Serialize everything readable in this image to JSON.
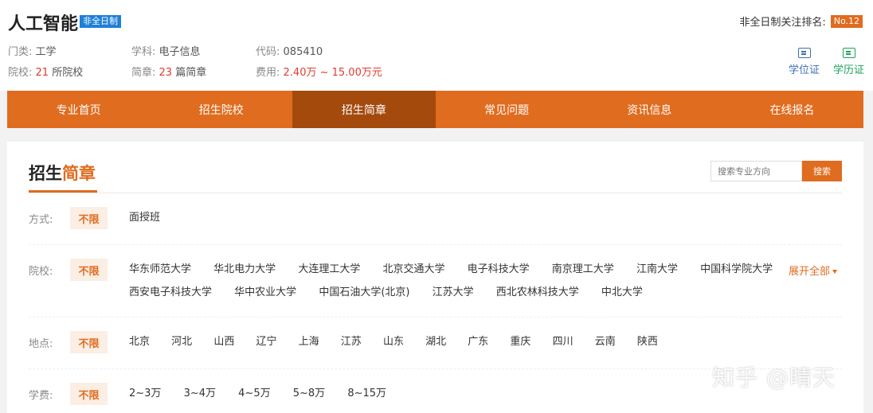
{
  "header": {
    "title": "人工智能",
    "badge": "非全日制",
    "rank_label": "非全日制关注排名:",
    "rank_value": "No.12",
    "category_key": "门类:",
    "category_val": "工学",
    "subject_key": "学科:",
    "subject_val": "电子信息",
    "code_key": "代码:",
    "code_val": "085410",
    "schools_key": "院校:",
    "schools_count": "21",
    "schools_suffix": "所院校",
    "brochure_key": "简章:",
    "brochure_count": "23",
    "brochure_suffix": "篇简章",
    "fee_key": "费用:",
    "fee_val": "2.40万 ~ 15.00万元",
    "degree_cert": "学位证",
    "edu_cert": "学历证",
    "degree_cert_color": "#3d6fb6",
    "edu_cert_color": "#1aa35a"
  },
  "nav": [
    "专业首页",
    "招生院校",
    "招生简章",
    "常见问题",
    "资讯信息",
    "在线报名"
  ],
  "nav_active_index": 2,
  "panel": {
    "title_a": "招生",
    "title_b": "简章",
    "search_placeholder": "搜索专业方向",
    "search_button": "搜索"
  },
  "filters": {
    "all_label": "不限",
    "mode": {
      "label": "方式:",
      "options": [
        "面授班"
      ]
    },
    "school": {
      "label": "院校:",
      "line1": [
        "华东师范大学",
        "华北电力大学",
        "大连理工大学",
        "北京交通大学",
        "电子科技大学",
        "南京理工大学",
        "江南大学",
        "中国科学院大学"
      ],
      "line2": [
        "西安电子科技大学",
        "华中农业大学",
        "中国石油大学(北京)",
        "江苏大学",
        "西北农林科技大学",
        "中北大学"
      ],
      "expand": "展开全部"
    },
    "region": {
      "label": "地点:",
      "options": [
        "北京",
        "河北",
        "山西",
        "辽宁",
        "上海",
        "江苏",
        "山东",
        "湖北",
        "广东",
        "重庆",
        "四川",
        "云南",
        "陕西"
      ]
    },
    "fee": {
      "label": "学费:",
      "options": [
        "2~3万",
        "3~4万",
        "4~5万",
        "5~8万",
        "8~15万"
      ]
    }
  },
  "watermark": "知乎 @晴天",
  "colors": {
    "accent": "#e06c1f",
    "accent_dark": "#a44a0d",
    "badge_blue": "#1e7fd6",
    "price_red": "#e23b2e"
  }
}
